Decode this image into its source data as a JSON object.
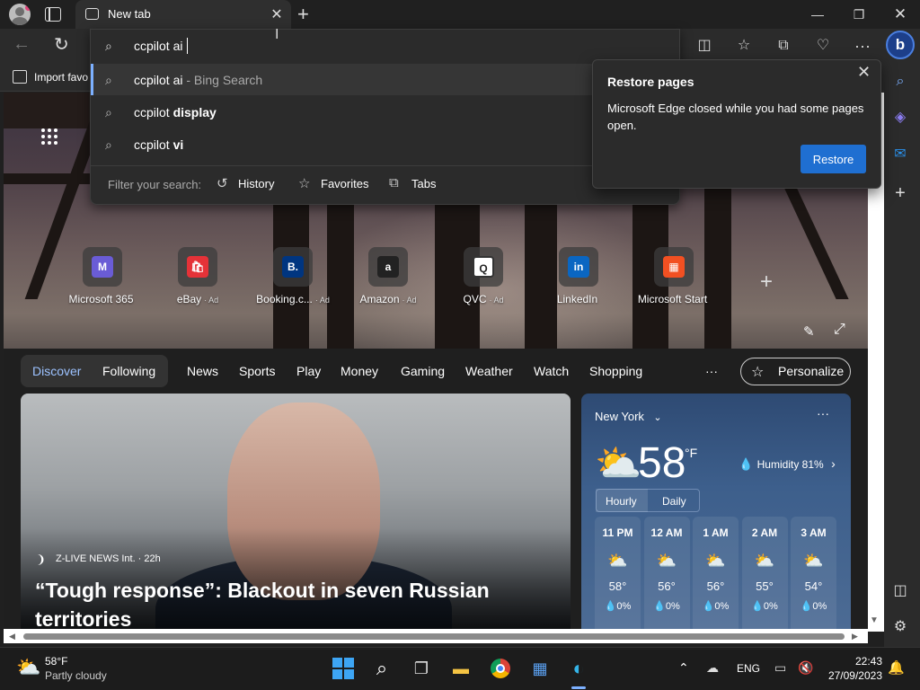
{
  "tab": {
    "title": "New tab"
  },
  "address": {
    "query": "ccpilot ai"
  },
  "suggestions": [
    {
      "base": "ccpilot ai",
      "suffix": " - Bing Search",
      "bold": ""
    },
    {
      "base": "ccpilot ",
      "suffix": "",
      "bold": "display"
    },
    {
      "base": "ccpilot ",
      "suffix": "",
      "bold": "vi"
    }
  ],
  "filter": {
    "label": "Filter your search:",
    "history": "History",
    "favorites": "Favorites",
    "tabs": "Tabs"
  },
  "favbar": {
    "import": "Import favo"
  },
  "restore": {
    "title": "Restore pages",
    "message": "Microsoft Edge closed while you had some pages open.",
    "button": "Restore"
  },
  "quick_links": [
    {
      "label": "Microsoft 365",
      "ad": "",
      "logo": "M",
      "color": "#6a5cd6"
    },
    {
      "label": "eBay",
      "ad": "Ad",
      "logo": "🛍",
      "color": "#e53238"
    },
    {
      "label": "Booking.c...",
      "ad": "Ad",
      "logo": "B.",
      "color": "#003580"
    },
    {
      "label": "Amazon",
      "ad": "Ad",
      "logo": "a",
      "color": "#222222"
    },
    {
      "label": "QVC",
      "ad": "Ad",
      "logo": "Q",
      "color": "#ffffff"
    },
    {
      "label": "LinkedIn",
      "ad": "",
      "logo": "in",
      "color": "#0a66c2"
    },
    {
      "label": "Microsoft Start",
      "ad": "",
      "logo": "▦",
      "color": "#f25022"
    }
  ],
  "feed_nav": {
    "discover": "Discover",
    "following": "Following",
    "items": [
      "News",
      "Sports",
      "Play",
      "Money",
      "Gaming",
      "Weather",
      "Watch",
      "Shopping"
    ],
    "more": "···",
    "personalize": "Personalize"
  },
  "news": {
    "source": "Z-LIVE NEWS Int. · 22h",
    "headline": "“Tough response”: Blackout in seven Russian territories"
  },
  "weather": {
    "city": "New York",
    "temp": "58",
    "unit": "°F",
    "humidity": "Humidity 81%",
    "tab_hourly": "Hourly",
    "tab_daily": "Daily",
    "hours": [
      {
        "time": "11 PM",
        "temp": "58°",
        "precip": "0%"
      },
      {
        "time": "12 AM",
        "temp": "56°",
        "precip": "0%"
      },
      {
        "time": "1 AM",
        "temp": "56°",
        "precip": "0%"
      },
      {
        "time": "2 AM",
        "temp": "55°",
        "precip": "0%"
      },
      {
        "time": "3 AM",
        "temp": "54°",
        "precip": "0%"
      }
    ]
  },
  "taskbar": {
    "temp": "58°F",
    "condition": "Partly cloudy",
    "language": "ENG",
    "time": "22:43",
    "date": "27/09/2023"
  },
  "colors": {
    "accent": "#1f6fd1",
    "discover": "#9cc2ff"
  }
}
